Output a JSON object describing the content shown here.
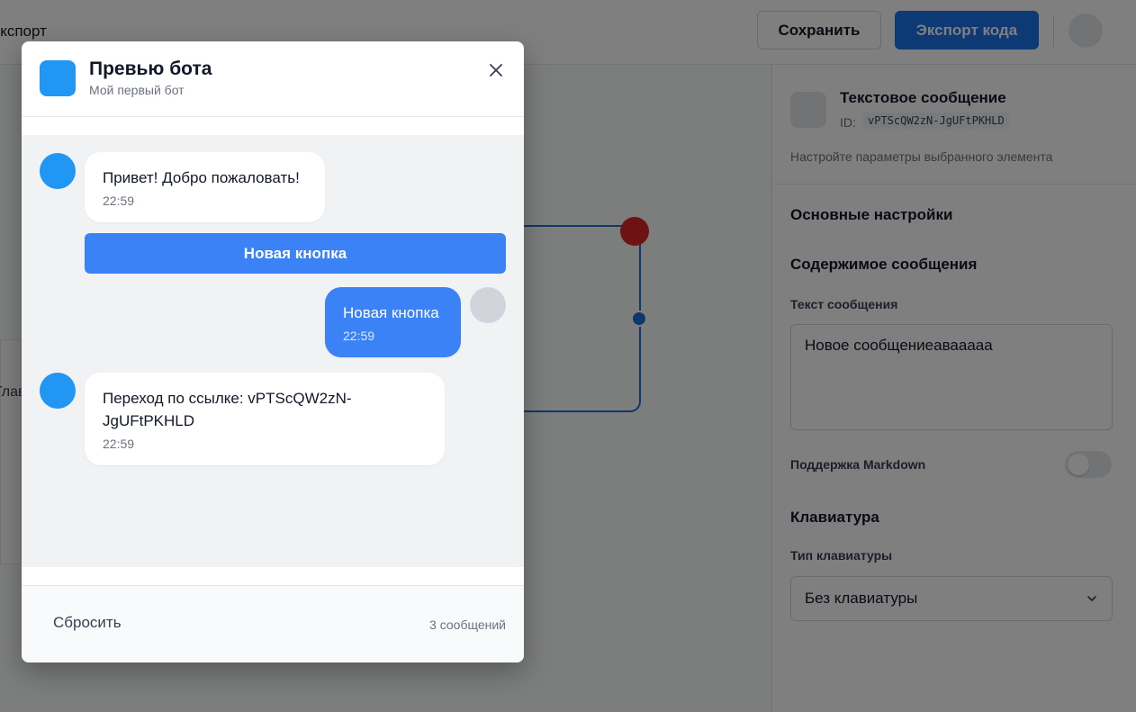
{
  "app": {
    "topbar": {
      "left_label": "Экспорт",
      "save_label": "Сохранить",
      "export_label": "Экспорт кода"
    },
    "canvas": {
      "node_label": "Главное"
    },
    "panel": {
      "element_type": "Текстовое сообщение",
      "id_label": "ID:",
      "id_value": "vPTScQW2zN-JgUFtPKHLD",
      "description": "Настройте параметры выбранного элемента",
      "basic_settings": "Основные настройки",
      "content_heading": "Содержимое сообщения",
      "message_text_label": "Текст сообщения",
      "message_text_value": "Новое сообщениеавааааа",
      "markdown_label": "Поддержка Markdown",
      "markdown_enabled": false,
      "keyboard_heading": "Клавиатура",
      "keyboard_type_label": "Тип клавиатуры",
      "keyboard_type_value": "Без клавиатуры"
    }
  },
  "modal": {
    "title": "Превью бота",
    "subtitle": "Мой первый бот",
    "close_icon": "close-icon",
    "messages": [
      {
        "from": "bot",
        "text": "Привет! Добро пожаловать!",
        "time": "22:59"
      },
      {
        "from": "user",
        "text": "Новая кнопка",
        "time": "22:59"
      },
      {
        "from": "bot",
        "text": "Переход по ссылке: vPTScQW2zN-JgUFtPKHLD",
        "time": "22:59"
      }
    ],
    "inline_button": "Новая кнопка",
    "reset_label": "Сбросить",
    "message_count": "3 сообщений"
  },
  "colors": {
    "accent": "#3b82f6",
    "bot_avatar": "#2196f3",
    "export_button": "#1a73e8",
    "node_dot": "#dc2626"
  }
}
